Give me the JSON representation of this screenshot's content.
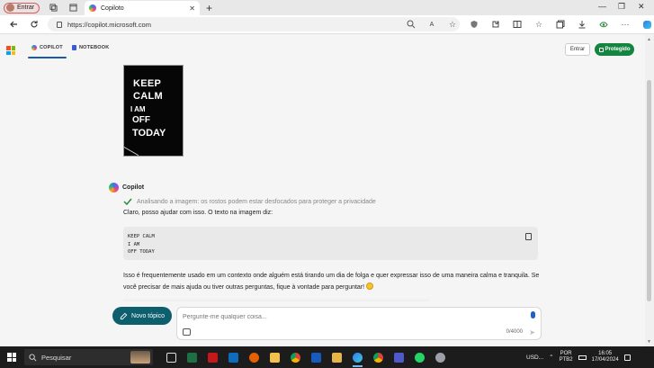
{
  "browser": {
    "profile_label": "Entrar",
    "tab_title": "Copiloto",
    "url": "https://copilot.microsoft.com"
  },
  "page": {
    "tabs": [
      {
        "label": "COPILOT",
        "active": true
      },
      {
        "label": "NOTEBOOK",
        "active": false
      }
    ],
    "entrar_label": "Entrar",
    "protegido_label": "Protegido",
    "poster": {
      "lines": [
        "KEEP",
        "CALM",
        "I AM",
        "OFF",
        "TODAY"
      ]
    },
    "assistant_name": "Copilot",
    "status_text": "Analisando a imagem: os rostos podem estar desfocados para proteger a privacidade",
    "reply_intro": "Claro, posso ajudar com isso. O texto na imagem diz:",
    "code_lines": [
      "KEEP CALM",
      "I AM",
      "OFF TODAY"
    ],
    "body_text": "Isso é frequentemente usado em um contexto onde alguém está tirando um dia de folga e quer expressar isso de uma maneira calma e tranquila. Se você precisar de mais ajuda ou tiver outras perguntas, fique à vontade para perguntar!",
    "new_topic_label": "Novo tópico",
    "input_placeholder": "Pergunte-me qualquer coisa...",
    "char_counter": "0/4000"
  },
  "taskbar": {
    "search_label": "Pesquisar",
    "weather": "USD...",
    "lang_top": "POR",
    "lang_bottom": "PTB2",
    "time": "16:05",
    "date": "17/04/2024"
  },
  "colors": {
    "accent_green": "#13853e",
    "new_topic_bg": "#0e5f6e",
    "tab_underline": "#1b5aa6"
  }
}
